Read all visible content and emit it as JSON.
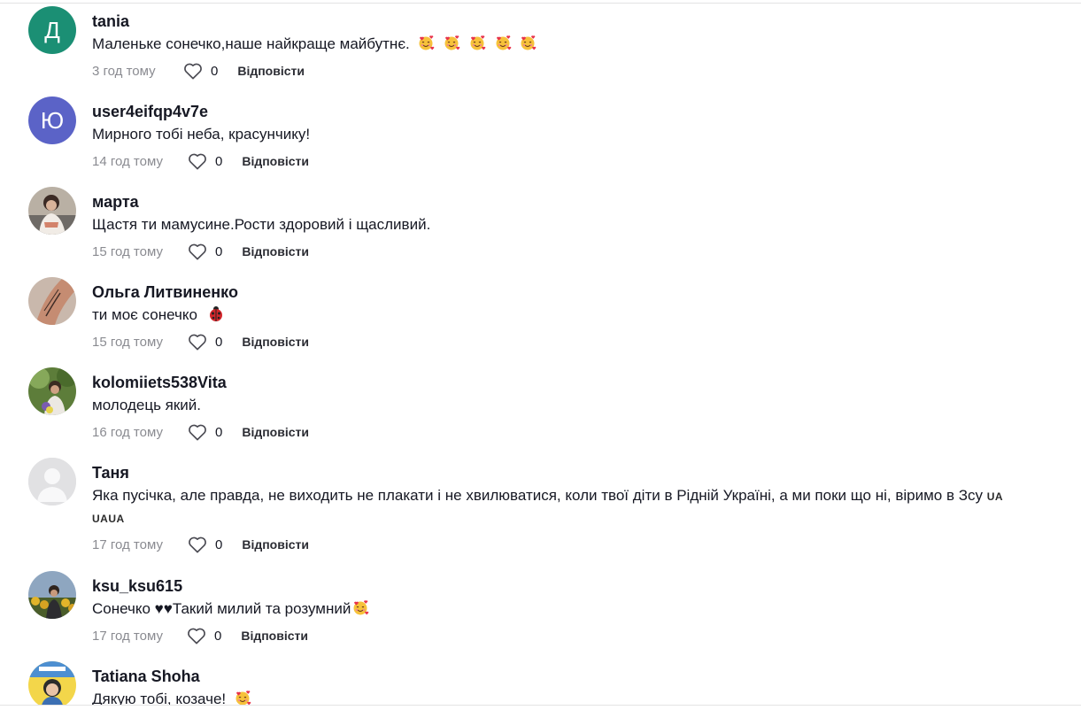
{
  "comments": [
    {
      "username": "tania",
      "text": "Маленьке сонечко,наше найкраще майбутнє.",
      "time": "3 год тому",
      "likes": "0",
      "reply": "Відповісти",
      "avatar_letter": "Д",
      "avatar_color": "#1b8f74"
    },
    {
      "username": "user4eifqp4v7e",
      "text": "Мирного тобі неба, красунчику!",
      "time": "14 год тому",
      "likes": "0",
      "reply": "Відповісти",
      "avatar_letter": "Ю",
      "avatar_color": "#5b63c7"
    },
    {
      "username": "марта",
      "text": "Щастя ти мамусине.Рости здоровий і щасливий.",
      "time": "15 год тому",
      "likes": "0",
      "reply": "Відповісти"
    },
    {
      "username": "Ольга Литвиненко",
      "text": "ти моє сонечко",
      "time": "15 год тому",
      "likes": "0",
      "reply": "Відповісти"
    },
    {
      "username": "kolomiiets538Vita",
      "text": "молодець який.",
      "time": "16 год тому",
      "likes": "0",
      "reply": "Відповісти"
    },
    {
      "username": "Таня",
      "text": "Яка пусічка, але правда, не виходить не плакати і не хвилюватися, коли твої діти в Рідній Україні, а ми поки що ні, віримо в Зсу",
      "flag_inline": "UA",
      "flag_line2": "UAUA",
      "time": "17 год тому",
      "likes": "0",
      "reply": "Відповісти"
    },
    {
      "username": "ksu_ksu615",
      "text": "Сонечко ♥♥Такий милий та розумний",
      "time": "17 год тому",
      "likes": "0",
      "reply": "Відповісти"
    },
    {
      "username": "Tatiana Shoha",
      "text": "Дякую тобі, козаче!"
    }
  ],
  "icons": {
    "like": "heart-outline-icon",
    "emoji_love": "smiling-face-with-hearts-icon",
    "emoji_ladybug": "ladybug-icon"
  }
}
